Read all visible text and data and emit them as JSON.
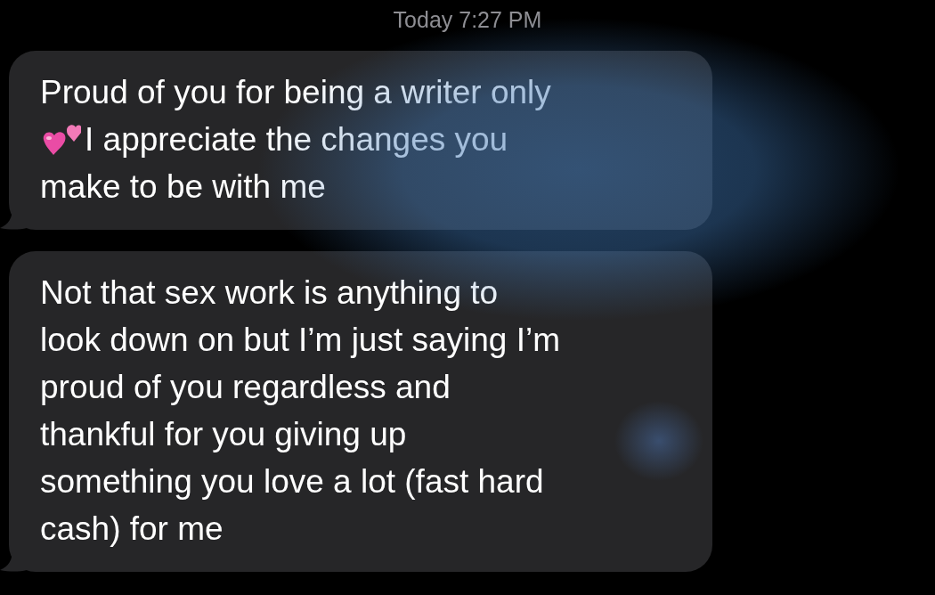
{
  "timestamp": {
    "day": "Today",
    "time": "7:27 PM"
  },
  "messages": [
    {
      "lines": [
        {
          "text": "Proud of you for being a writer only"
        },
        {
          "kind": "emoji",
          "text": "I appreciate the changes you"
        },
        {
          "text": "make to be with me"
        }
      ]
    },
    {
      "lines": [
        {
          "text": "Not that sex work is anything to"
        },
        {
          "text": "look down on but I’m just saying I’m"
        },
        {
          "text": "proud of you regardless and"
        },
        {
          "text": "thankful for you giving up"
        },
        {
          "text": "something you love a lot (fast hard"
        },
        {
          "text": "cash) for me"
        }
      ]
    }
  ]
}
